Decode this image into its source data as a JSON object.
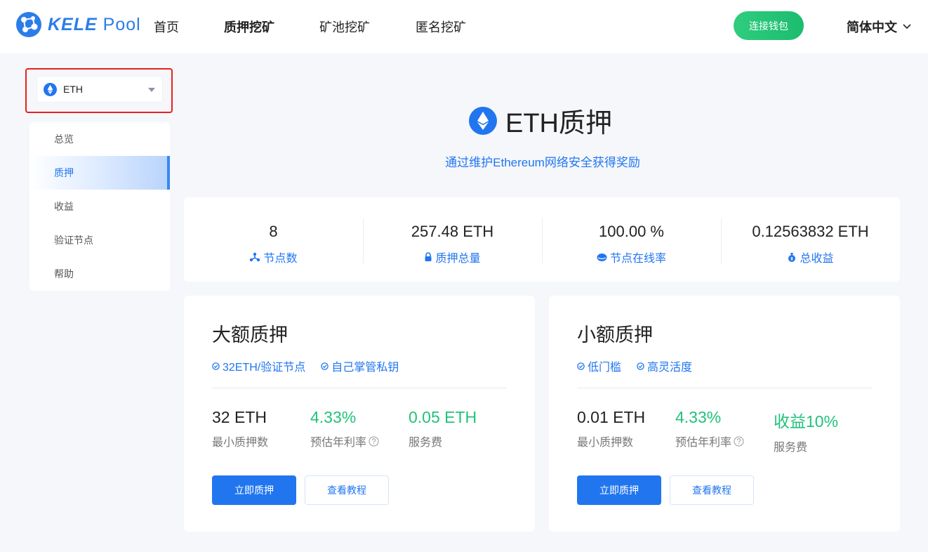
{
  "header": {
    "logo_text": "KELE",
    "logo_text_light": "Pool",
    "nav": [
      "首页",
      "质押挖矿",
      "矿池挖矿",
      "匿名挖矿"
    ],
    "active_nav": "质押挖矿",
    "connect_button": "连接钱包",
    "language": "简体中文"
  },
  "sidebar": {
    "coin_select": {
      "value": "ETH"
    },
    "items": [
      {
        "label": "总览"
      },
      {
        "label": "质押",
        "active": true
      },
      {
        "label": "收益"
      },
      {
        "label": "验证节点"
      },
      {
        "label": "帮助"
      }
    ]
  },
  "main": {
    "title": "ETH质押",
    "subtitle": "通过维护Ethereum网络安全获得奖励",
    "stats": [
      {
        "value": "8",
        "label": "节点数",
        "icon": "nodes-icon"
      },
      {
        "value": "257.48 ETH",
        "label": "质押总量",
        "icon": "lock-icon"
      },
      {
        "value": "100.00 %",
        "label": "节点在线率",
        "icon": "online-icon"
      },
      {
        "value": "0.12563832 ETH",
        "label": "总收益",
        "icon": "moneybag-icon"
      }
    ],
    "cards": [
      {
        "title": "大额质押",
        "tags": [
          "32ETH/验证节点",
          "自己掌管私钥"
        ],
        "metrics": [
          {
            "value": "32 ETH",
            "label": "最小质押数"
          },
          {
            "value": "4.33%",
            "label": "预估年利率"
          },
          {
            "value": "0.05 ETH",
            "label": "服务费"
          }
        ],
        "primary_button": "立即质押",
        "secondary_button": "查看教程"
      },
      {
        "title": "小额质押",
        "tags": [
          "低门槛",
          "高灵活度"
        ],
        "metrics": [
          {
            "value": "0.01 ETH",
            "label": "最小质押数"
          },
          {
            "value": "4.33%",
            "label": "预估年利率"
          },
          {
            "value": "收益10%",
            "label": "服务费"
          }
        ],
        "primary_button": "立即质押",
        "secondary_button": "查看教程"
      }
    ]
  },
  "colors": {
    "brand_blue": "#2176f0",
    "green": "#22c27a",
    "connect_green": "#2fcd7e",
    "highlight_red": "#e8201c"
  }
}
